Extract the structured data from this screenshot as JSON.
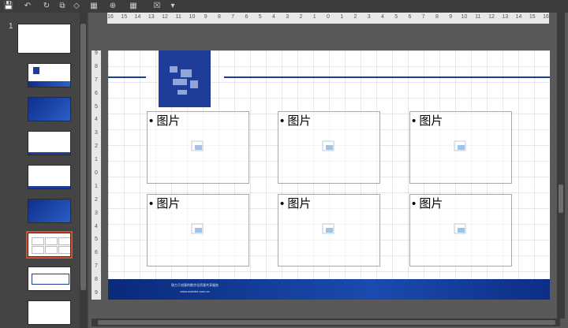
{
  "qat": {
    "save_icon": "💾",
    "undo_icon": "↶",
    "redo_icon": "↻",
    "format_icon": "⧉",
    "shapes_icon": "◇",
    "table_icon": "▦",
    "arrange_icon": "⊕",
    "close_icon": "☒",
    "more_icon": "▾"
  },
  "sidebar": {
    "first_slide_number": "1"
  },
  "ruler": {
    "h_ticks": [
      "16",
      "15",
      "14",
      "13",
      "12",
      "11",
      "10",
      "9",
      "8",
      "7",
      "6",
      "5",
      "4",
      "3",
      "2",
      "1",
      "0",
      "1",
      "2",
      "3",
      "4",
      "5",
      "6",
      "7",
      "8",
      "9",
      "10",
      "11",
      "12",
      "13",
      "14",
      "15",
      "16"
    ],
    "v_ticks": [
      "9",
      "8",
      "7",
      "6",
      "5",
      "4",
      "3",
      "2",
      "1",
      "0",
      "1",
      "2",
      "3",
      "4",
      "5",
      "6",
      "7",
      "8",
      "9"
    ]
  },
  "slide": {
    "placeholders": [
      "• 图片",
      "• 图片",
      "• 图片",
      "• 图片",
      "• 图片",
      "• 图片"
    ],
    "footer_line1": "致力于创意的数字化资源共享服务",
    "footer_line2": "www.worldex.com.cn"
  }
}
